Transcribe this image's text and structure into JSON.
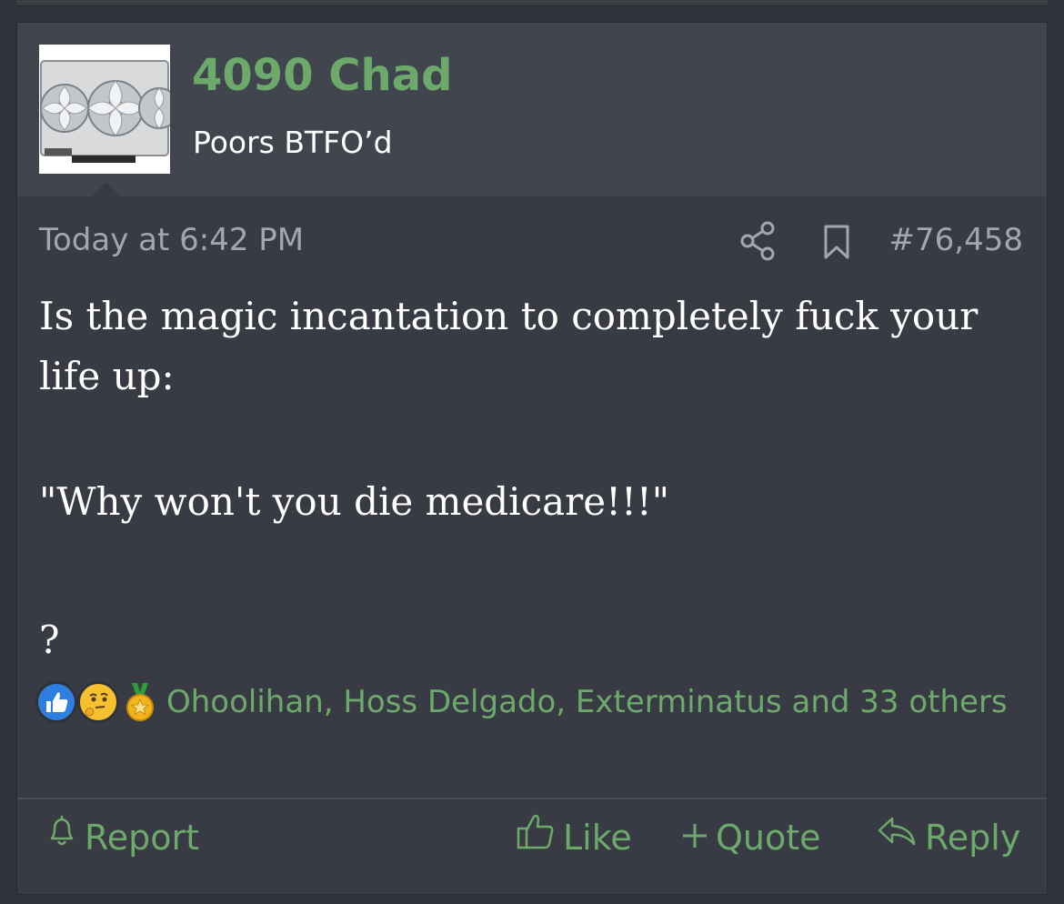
{
  "post": {
    "author": {
      "username": "4090 Chad",
      "user_title": "Poors BTFO’d",
      "avatar_icon": "graphics-card-avatar"
    },
    "meta": {
      "date": "Today at 6:42 PM",
      "post_number": "#76,458",
      "share_icon": "share-icon",
      "bookmark_icon": "bookmark-icon"
    },
    "body": {
      "line1": "Is the magic incantation to completely fuck your life up:",
      "line2": "\"Why won't you die medicare!!!\"",
      "line3": "?"
    },
    "reactions": {
      "icons": [
        "like-reaction-icon",
        "thinking-reaction-icon",
        "medal-reaction-icon"
      ],
      "text": "Ohoolihan, Hoss Delgado, Exterminatus and 33 others"
    },
    "actions": {
      "report": "Report",
      "like": "Like",
      "quote": "Quote",
      "reply": "Reply"
    }
  },
  "colors": {
    "accent_green": "#6da96b",
    "header_bg": "#41454d",
    "post_bg": "#383b43",
    "meta_gray": "#a2a7ae"
  }
}
